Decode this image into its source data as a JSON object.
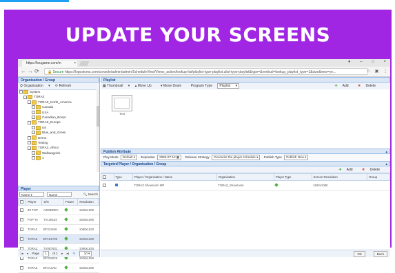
{
  "banner": {
    "title": "UPDATE YOUR SCREENS",
    "color": "#a126e4"
  },
  "browser": {
    "tab_title": "https://tougame.com/m",
    "url_secure": "Secure",
    "url": "https://logostcms.com/console/admin/admin/ScheduleView/Views_action/lookup-list/playlist-type-playlist.ulist-type-playlist&type=&vertical=lookup_playlist_type=1&size&new=ye..."
  },
  "left": {
    "org_header": "Organisation / Group",
    "org_toolbar": {
      "organisation": "Organisation",
      "refresh": "Refresh"
    },
    "tree": [
      {
        "label": "System",
        "indent": 0
      },
      {
        "label": "TORAZ",
        "indent": 1
      },
      {
        "label": "TORAZ_North_America",
        "indent": 2
      },
      {
        "label": "Canada",
        "indent": 3
      },
      {
        "label": "USA",
        "indent": 3
      },
      {
        "label": "Canadian_Bonpt",
        "indent": 3
      },
      {
        "label": "TORAZ_Europe",
        "indent": 2
      },
      {
        "label": "UK",
        "indent": 3
      },
      {
        "label": "Blue_and_Green",
        "indent": 3
      },
      {
        "label": "Demo",
        "indent": 2
      },
      {
        "label": "Testing",
        "indent": 2
      },
      {
        "label": "TORAZ_Africa",
        "indent": 2
      },
      {
        "label": "Walkwaypick",
        "indent": 3
      },
      {
        "label": "1",
        "indent": 3
      }
    ],
    "player": {
      "header": "Player",
      "filter_field": "Name",
      "filter_value": "Name",
      "search": "Search",
      "columns": [
        "Player",
        "S/N",
        "Power",
        "Resolution"
      ],
      "rows": [
        {
          "player": "ZZ TOP",
          "sn": "A338EDEC",
          "power": "on",
          "res": "1920x1080"
        },
        {
          "player": "POP TA",
          "sn": "TV138183",
          "power": "on",
          "res": "1920x1080"
        },
        {
          "player": "TORAZ",
          "sn": "BF311949",
          "power": "on",
          "res": "1080x1920"
        },
        {
          "player": "TORAZ",
          "sn": "BF1E6798",
          "power": "on",
          "res": "1920x1080"
        },
        {
          "player": "TORAZ",
          "sn": "TV0E7931",
          "power": "on",
          "res": "1080x1920"
        },
        {
          "player": "TORAZ",
          "sn": "BF3328C8",
          "power": "on",
          "res": "1920x1080"
        },
        {
          "player": "TORAZ",
          "sn": "BF2A3AD",
          "power": "on",
          "res": "1920x1080"
        }
      ],
      "pager": {
        "page_label": "Page",
        "page": "1",
        "of": "of 1",
        "size": "10"
      }
    }
  },
  "right": {
    "playlist_header": "Playlist",
    "toolbar": {
      "thumbnail": "Thumbnail",
      "move_up": "Move Up",
      "move_down": "Move Down",
      "program_type": "Program Type",
      "program_value": "Playlist",
      "add": "Add",
      "delete": "Delete"
    },
    "thumb_label": "Test",
    "publish_header": "Publish Attribute",
    "publish": {
      "play_mode_label": "Play Mode",
      "play_mode": "Default",
      "expiration_label": "Expiration",
      "expiration": "2066-07-12",
      "release_label": "Release Strategy",
      "release": "Overwrite the player schedule",
      "publish_type_label": "Publish Type",
      "publish_type": "Publish Now"
    },
    "target_header": "Targeted Player / Organisation / Group",
    "target_toolbar": {
      "add": "Add",
      "delete": "Delete"
    },
    "target_columns": [
      "Type",
      "Player / Organisation / Name",
      "Organisation",
      "Player Type",
      "Screen Resolution",
      "Group"
    ],
    "target_rows": [
      {
        "name": "TORAZ Showroom MP",
        "org": "TORAZ_Showroom",
        "res": "1920x1080",
        "group": ""
      }
    ],
    "buttons": {
      "ok": "OK",
      "back": "Back"
    }
  }
}
